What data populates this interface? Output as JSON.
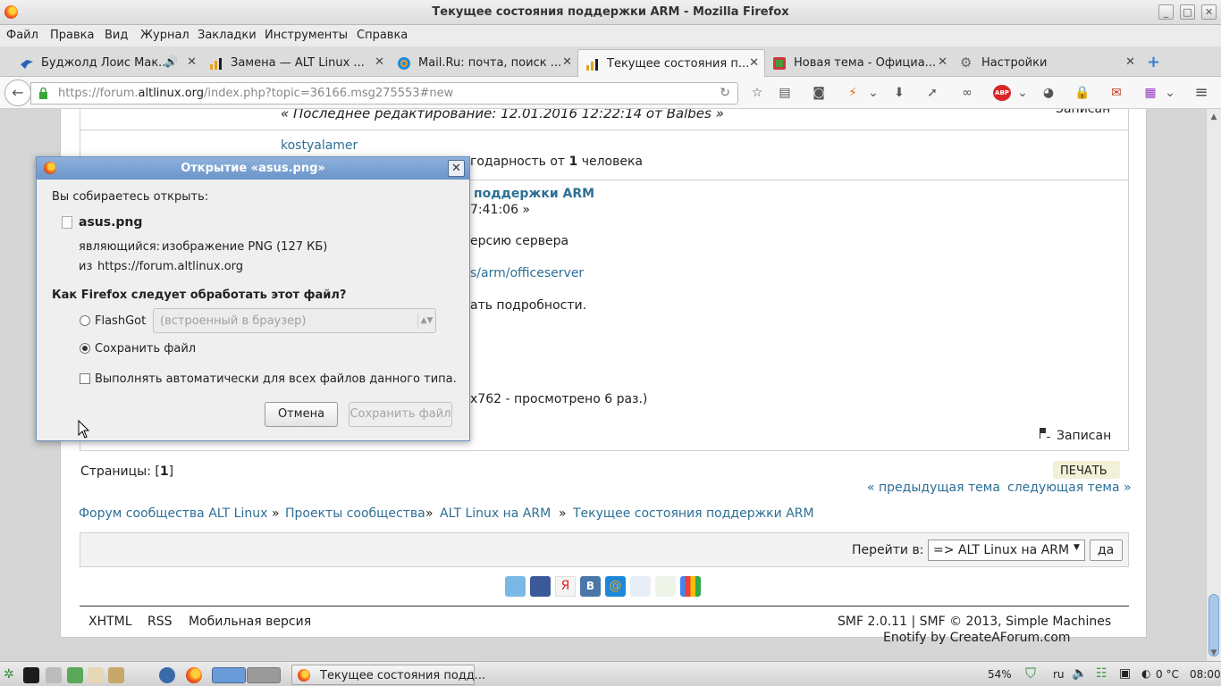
{
  "window": {
    "title": "Текущее состояния поддержки ARM - Mozilla Firefox",
    "minimize": "_",
    "maximize": "□",
    "close": "✕"
  },
  "menu": [
    "Файл",
    "Правка",
    "Вид",
    "Журнал",
    "Закладки",
    "Инструменты",
    "Справка"
  ],
  "tabs": [
    {
      "label": "Буджолд Лоис Мак...",
      "active": false,
      "audio": "🔊"
    },
    {
      "label": "Замена — ALT Linux ...",
      "active": false
    },
    {
      "label": "Mail.Ru: почта, поиск ...",
      "active": false
    },
    {
      "label": "Текущее состояния п...",
      "active": true
    },
    {
      "label": "Новая тема - Официа...",
      "active": false
    },
    {
      "label": "Настройки",
      "active": false
    }
  ],
  "tab_close": "✕",
  "newtab": "+",
  "nav": {
    "back": "←",
    "url_prefix": "https://forum.",
    "url_domain": "altlinux.org",
    "url_suffix": "/index.php?topic=36166.msg275553#new",
    "reload": "↻"
  },
  "toolbar_icons": [
    "☆",
    "▤",
    "◙",
    "⚡",
    "⌄",
    "⬇",
    "➚",
    "∞",
    "ABP",
    "⌄",
    "◕",
    "🔒",
    "✉",
    "▦",
    "⌄",
    "≡"
  ],
  "page": {
    "last_edit": "« Последнее редактирование: 12.01.2016 12:22:14 от Balbes »",
    "posted_top": "Записан",
    "user1": "kostyalamer",
    "thanks_pre": "годарность от ",
    "thanks_count": "1",
    "thanks_post": " человека",
    "post_title_fragment": "поддержки ARM",
    "post_date_fragment": "7:41:06 »",
    "post_line1": "ерсию сервера",
    "post_link": "s/arm/officeserver",
    "post_line2": "ать подробности.",
    "post_line3": "x762 - просмотрено 6 раз.)",
    "posted_bottom": "Записан",
    "pages_label": "Страницы: [",
    "pages_current": "1",
    "pages_close": "]",
    "print": "ПЕЧАТЬ",
    "prev_topic": "« предыдущая тема",
    "next_topic": "следующая тема »",
    "breadcrumb": [
      "Форум сообщества ALT Linux",
      "Проекты сообщества",
      "ALT Linux на ARM",
      "Текущее состояния поддержки ARM"
    ],
    "breadcrumb_sep": "»",
    "jump_label": "Перейти в:",
    "jump_value": "=> ALT Linux на ARM",
    "jump_go": "да",
    "footer_links": [
      "XHTML",
      "RSS",
      "Мобильная версия"
    ],
    "footer_right1": "SMF 2.0.11 | SMF © 2013, Simple Machines",
    "footer_right2": "Enotify by CreateAForum.com"
  },
  "dialog": {
    "title": "Открытие «asus.png»",
    "close": "✕",
    "about_to_open": "Вы собираетесь открыть:",
    "filename": "asus.png",
    "type_label": "являющийся:",
    "type_value": "изображение PNG (127 КБ)",
    "from_label": "из",
    "from_value": "https://forum.altlinux.org",
    "question": "Как Firefox следует обработать этот файл?",
    "option_open": "FlashGot",
    "option_open_select": "(встроенный в браузер)",
    "option_save": "Сохранить файл",
    "auto_checkbox": "Выполнять автоматически для всех файлов данного типа.",
    "cancel": "Отмена",
    "save": "Сохранить файл"
  },
  "taskbar": {
    "task_label": "Текущее состояния подд...",
    "battery": "54%",
    "lang": "ru",
    "temp": "0 °C",
    "clock": "08:00"
  },
  "colors": {
    "link": "#2d6f96",
    "dialog_title": "#6a94c9",
    "print_bg": "#f2f0d6"
  }
}
